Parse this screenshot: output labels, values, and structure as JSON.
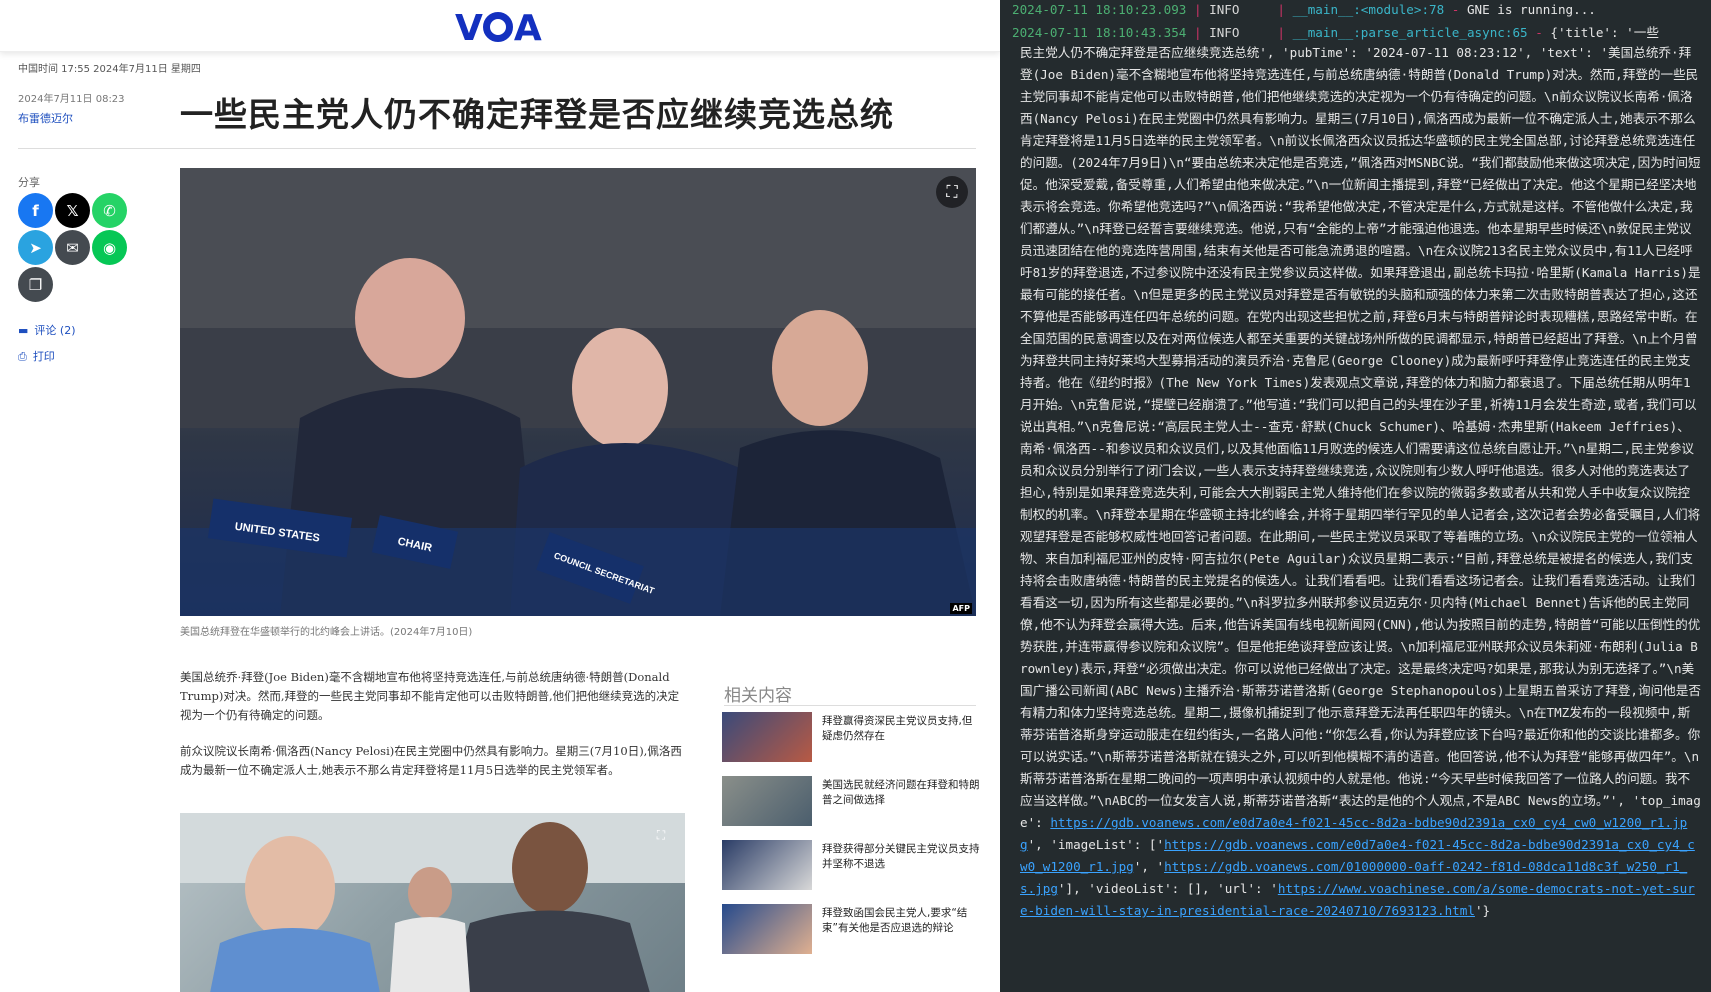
{
  "browser": {
    "logo": "VOA",
    "timestamp_bar": "中国时间 17:55 2024年7月11日 星期四",
    "meta_date": "2024年7月11日 08:23",
    "author": "布雷德迈尔",
    "headline": "一些民主党人仍不确定拜登是否应继续竞选总统",
    "share_label": "分享",
    "share_buttons": [
      {
        "name": "facebook",
        "glyph": "f",
        "color": "#1877f2"
      },
      {
        "name": "x",
        "glyph": "𝕏",
        "color": "#000000"
      },
      {
        "name": "whatsapp",
        "glyph": "✆",
        "color": "#25d366"
      },
      {
        "name": "telegram",
        "glyph": "➤",
        "color": "#2aa3e0"
      },
      {
        "name": "email",
        "glyph": "✉",
        "color": "#444a50"
      },
      {
        "name": "line",
        "glyph": "◉",
        "color": "#06c755"
      },
      {
        "name": "copy",
        "glyph": "❐",
        "color": "#444a50"
      }
    ],
    "comments_label": "评论 (2)",
    "print_label": "打印",
    "hero_caption": "美国总统拜登在华盛顿举行的北约峰会上讲话。(2024年7月10日)",
    "hero_afp": "AFP",
    "hero_placards": [
      "UNITED STATES",
      "CHAIR",
      "COUNCIL SECRETARIAT"
    ],
    "paragraphs": [
      "美国总统乔·拜登(Joe Biden)毫不含糊地宣布他将坚持竞选连任,与前总统唐纳德·特朗普(Donald Trump)对决。然而,拜登的一些民主党同事却不能肯定他可以击败特朗普,他们把他继续竞选的决定视为一个仍有待确定的问题。",
      "前众议院议长南希·佩洛西(Nancy Pelosi)在民主党圈中仍然具有影响力。星期三(7月10日),佩洛西成为最新一位不确定派人士,她表示不那么肯定拜登将是11月5日选举的民主党领军者。"
    ],
    "related": {
      "title": "相关内容",
      "items": [
        {
          "text": "拜登赢得资深民主党议员支持,但疑虑仍然存在"
        },
        {
          "text": "美国选民就经济问题在拜登和特朗普之间做选择"
        },
        {
          "text": "拜登获得部分关键民主党议员支持并坚称不退选"
        },
        {
          "text": "拜登致函国会民主党人,要求“结束”有关他是否应退选的辩论"
        }
      ]
    }
  },
  "terminal": {
    "line1": {
      "ts": "2024-07-11 18:10:23.093",
      "level": "INFO    ",
      "module": "__main__:<module>:78",
      "msg": "GNE is running..."
    },
    "line2": {
      "ts": "2024-07-11 18:10:43.354",
      "level": "INFO    ",
      "module": "__main__:parse_article_async:65",
      "msg": "{'title': '一些"
    },
    "body_text": "民主党人仍不确定拜登是否应继续竞选总统', 'pubTime': '2024-07-11 08:23:12', 'text': '美国总统乔·拜登(Joe Biden)毫不含糊地宣布他将坚持竞选连任,与前总统唐纳德·特朗普(Donald Trump)对决。然而,拜登的一些民主党同事却不能肯定他可以击败特朗普,他们把他继续竞选的决定视为一个仍有待确定的问题。\\n前众议院议长南希·佩洛西(Nancy Pelosi)在民主党圈中仍然具有影响力。星期三(7月10日),佩洛西成为最新一位不确定派人士,她表示不那么肯定拜登将是11月5日选举的民主党领军者。\\n前议长佩洛西众议员抵达华盛顿的民主党全国总部,讨论拜登总统竞选连任的问题。(2024年7月9日)\\n“要由总统来决定他是否竞选,”佩洛西对MSNBC说。“我们都鼓励他来做这项决定,因为时间短促。他深受爱戴,备受尊重,人们希望由他来做决定。”\\n一位新闻主播提到,拜登“已经做出了决定。他这个星期已经坚决地表示将会竞选。你希望他竞选吗?”\\n佩洛西说:“我希望他做决定,不管决定是什么,方式就是这样。不管他做什么决定,我们都遵从。”\\n拜登已经誓言要继续竞选。他说,只有“全能的上帝”才能强迫他退选。他本星期早些时候还\\n敦促民主党议员迅速团结在他的竞选阵营周围,结束有关他是否可能急流勇退的喧嚣。\\n在众议院213名民主党众议员中,有11人已经呼吁81岁的拜登退选,不过参议院中还没有民主党参议员这样做。如果拜登退出,副总统卡玛拉·哈里斯(Kamala Harris)是最有可能的接任者。\\n但是更多的民主党议员对拜登是否有敏锐的头脑和顽强的体力来第二次击败特朗普表达了担心,这还不算他是否能够再连任四年总统的问题。在党内出现这些担忧之前,拜登6月末与特朗普辩论时表现糟糕,思路经常中断。在全国范围的民意调查以及在对两位候选人都至关重要的关键战场州所做的民调都显示,特朗普已经超出了拜登。\\n上个月曾为拜登共同主持好莱坞大型募捐活动的演员乔治·克鲁尼(George Clooney)成为最新呼吁拜登停止竞选连任的民主党支持者。他在《纽约时报》(The New York Times)发表观点文章说,拜登的体力和脑力都衰退了。下届总统任期从明年1月开始。\\n克鲁尼说,“提壁已经崩溃了。”他写道:“我们可以把自己的头埋在沙子里,祈祷11月会发生奇迹,或者,我们可以说出真相。”\\n克鲁尼说:“高层民主党人士--查克·舒默(Chuck Schumer)、哈基姆·杰弗里斯(Hakeem Jeffries)、南希·佩洛西--和参议员和众议员们,以及其他面临11月败选的候选人们需要请这位总统自愿让开。”\\n星期二,民主党参议员和众议员分别举行了闭门会议,一些人表示支持拜登继续竞选,众议院则有少数人呼吁他退选。很多人对他的竞选表达了担心,特别是如果拜登竞选失利,可能会大大削弱民主党人维持他们在参议院的微弱多数或者从共和党人手中收复众议院控制权的机率。\\n拜登本星期在华盛顿主持北约峰会,并将于星期四举行罕见的单人记者会,这次记者会势必备受瞩目,人们将观望拜登是否能够权威性地回答记者问题。在此期间,一些民主党议员采取了等着瞧的立场。\\n众议院民主党的一位领袖人物、来自加利福尼亚州的皮特·阿吉拉尔(Pete Aguilar)众议员星期二表示:“目前,拜登总统是被提名的候选人,我们支持将会击败唐纳德·特朗普的民主党提名的候选人。让我们看看吧。让我们看看这场记者会。让我们看看竞选活动。让我们看看这一切,因为所有这些都是必要的。”\\n科罗拉多州联邦参议员迈克尔·贝内特(Michael Bennet)告诉他的民主党同僚,他不认为拜登会赢得大选。后来,他告诉美国有线电视新闻网(CNN),他认为按照目前的走势,特朗普“可能以压倒性的优势获胜,并连带赢得参议院和众议院”。但是他拒绝谈拜登应该让贤。\\n加利福尼亚州联邦众议员朱莉娅·布朗利(Julia Brownley)表示,拜登“必须做出决定。你可以说他已经做出了决定。这是最终决定吗?如果是,那我认为别无选择了。”\\n美国广播公司新闻(ABC News)主播乔治·斯蒂芬诺普洛斯(George Stephanopoulos)上星期五曾采访了拜登,询问他是否有精力和体力坚持竞选总统。星期二,摄像机捕捉到了他示意拜登无法再任职四年的镜头。\\n在TMZ发布的一段视频中,斯蒂芬诺普洛斯身穿运动服走在纽约街头,一名路人问他:“你怎么看,你认为拜登应该下台吗?最近你和他的交谈比谁都多。你可以说实话。”\\n斯蒂芬诺普洛斯就在镜头之外,可以听到他模糊不清的语音。他回答说,他不认为拜登“能够再做四年”。\\n斯蒂芬诺普洛斯在星期二晚间的一项声明中承认视频中的人就是他。他说:“今天早些时候我回答了一位路人的问题。我不应当这样做。”\\nABC的一位女发言人说,斯蒂芬诺普洛斯“表达的是他的个人观点,不是ABC News的立场。”', 'top_image': ",
    "top_image_url": "https://gdb.voanews.com/e0d7a0e4-f021-45cc-8d2a-bdbe90d2391a_cx0_cy4_cw0_w1200_r1.jpg",
    "image_list_label": "', 'imageList': ['",
    "image_list_url1": "https://gdb.voanews.com/e0d7a0e4-f021-45cc-8d2a-bdbe90d2391a_cx0_cy4_cw0_w1200_r1.jpg",
    "image_list_mid": "', '",
    "image_list_url2": "https://gdb.voanews.com/01000000-0aff-0242-f81d-08dca11d8c3f_w250_r1_s.jpg",
    "video_list": "'], 'videoList': [], 'url': '",
    "article_url": "https://www.voachinese.com/a/some-democrats-not-yet-sure-biden-will-stay-in-presidential-race-20240710/7693123.html",
    "tail": "'}"
  }
}
